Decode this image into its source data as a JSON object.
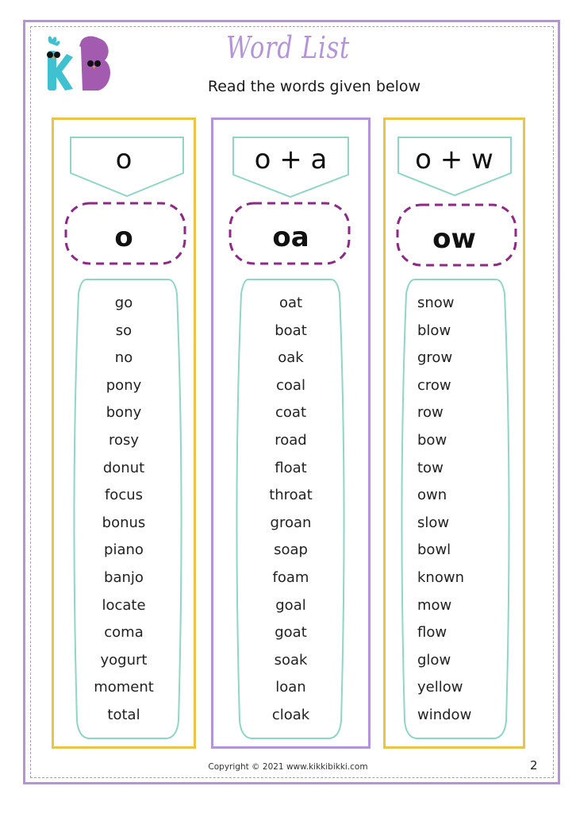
{
  "header": {
    "title": "Word List",
    "subtitle": "Read the words given below",
    "logo": {
      "letters": [
        "K",
        "B"
      ],
      "icon": "kikkibikki-logo-icon"
    }
  },
  "colors": {
    "page_border": "#b394d9",
    "column_yellow": "#e8c547",
    "column_purple": "#b394d9",
    "banner_teal": "#8fd6c4",
    "pill_dashed": "#8e2a86",
    "title_purple": "#b394d9",
    "logo_teal": "#3fc1cf",
    "logo_purple": "#a35bb0"
  },
  "columns": [
    {
      "formula": "o",
      "sound": "o",
      "words": [
        "go",
        "so",
        "no",
        "pony",
        "bony",
        "rosy",
        "donut",
        "focus",
        "bonus",
        "piano",
        "banjo",
        "locate",
        "coma",
        "yogurt",
        "moment",
        "total"
      ]
    },
    {
      "formula": "o + a",
      "sound": "oa",
      "words": [
        "oat",
        "boat",
        "oak",
        "coal",
        "coat",
        "road",
        "float",
        "throat",
        "groan",
        "soap",
        "foam",
        "goal",
        "goat",
        "soak",
        "loan",
        "cloak"
      ]
    },
    {
      "formula": "o + w",
      "sound": "ow",
      "words": [
        "snow",
        "blow",
        "grow",
        "crow",
        "row",
        "bow",
        "tow",
        "own",
        "slow",
        "bowl",
        "known",
        "mow",
        "flow",
        "glow",
        "yellow",
        "window"
      ]
    }
  ],
  "footer": {
    "copyright": "Copyright © 2021 www.kikkibikki.com",
    "page_number": "2"
  }
}
